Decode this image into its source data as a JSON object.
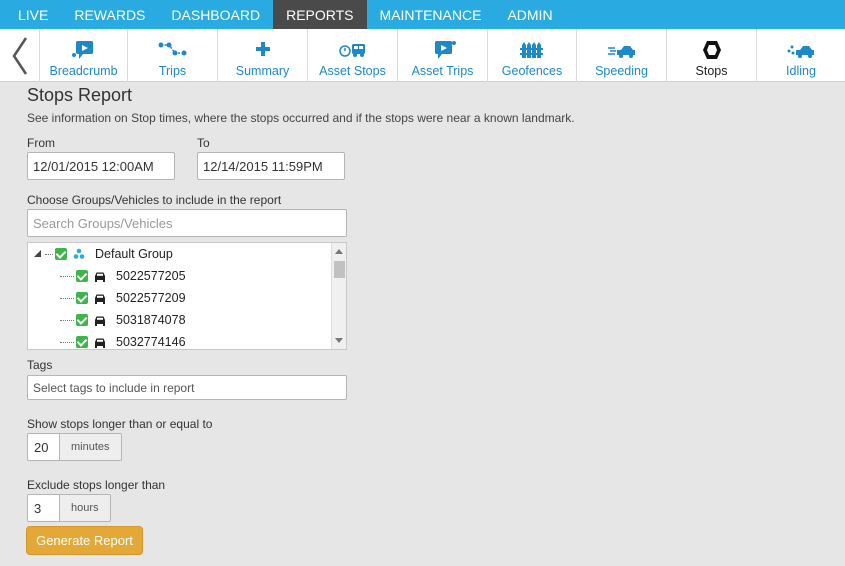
{
  "topnav": {
    "tabs": [
      {
        "label": "LIVE"
      },
      {
        "label": "REWARDS"
      },
      {
        "label": "DASHBOARD"
      },
      {
        "label": "REPORTS"
      },
      {
        "label": "MAINTENANCE"
      },
      {
        "label": "ADMIN"
      }
    ],
    "active": "REPORTS"
  },
  "subnav": {
    "items": [
      {
        "label": "Breadcrumb",
        "icon": "breadcrumb-icon"
      },
      {
        "label": "Trips",
        "icon": "trips-icon"
      },
      {
        "label": "Summary",
        "icon": "plus-icon"
      },
      {
        "label": "Asset Stops",
        "icon": "asset-stops-icon"
      },
      {
        "label": "Asset Trips",
        "icon": "asset-trips-icon"
      },
      {
        "label": "Geofences",
        "icon": "geofence-icon"
      },
      {
        "label": "Speeding",
        "icon": "speeding-icon"
      },
      {
        "label": "Stops",
        "icon": "stop-hexagon-icon"
      },
      {
        "label": "Idling",
        "icon": "idling-icon"
      }
    ],
    "active": "Stops",
    "accent": "#1e88c8"
  },
  "report": {
    "title": "Stops Report",
    "description": "See information on Stop times, where the stops occurred and if the stops were near a known landmark."
  },
  "from": {
    "label": "From",
    "value": "12/01/2015 12:00AM"
  },
  "to": {
    "label": "To",
    "value": "12/14/2015 11:59PM"
  },
  "groups": {
    "label": "Choose Groups/Vehicles to include in the report",
    "search_placeholder": "Search Groups/Vehicles",
    "tree": {
      "group": "Default Group",
      "vehicles": [
        "5022577205",
        "5022577209",
        "5031874078",
        "5032774146"
      ]
    }
  },
  "tags": {
    "label": "Tags",
    "placeholder": "Select tags to include in report"
  },
  "min_stop": {
    "label": "Show stops longer than or equal to",
    "value": "20",
    "unit": "minutes"
  },
  "max_stop": {
    "label": "Exclude stops longer than",
    "value": "3",
    "unit": "hours"
  },
  "generate_button": "Generate Report",
  "colors": {
    "topnav": "#29abe2",
    "active_tab": "#4a4a4a",
    "check": "#3db54a",
    "button": "#e4a838"
  }
}
